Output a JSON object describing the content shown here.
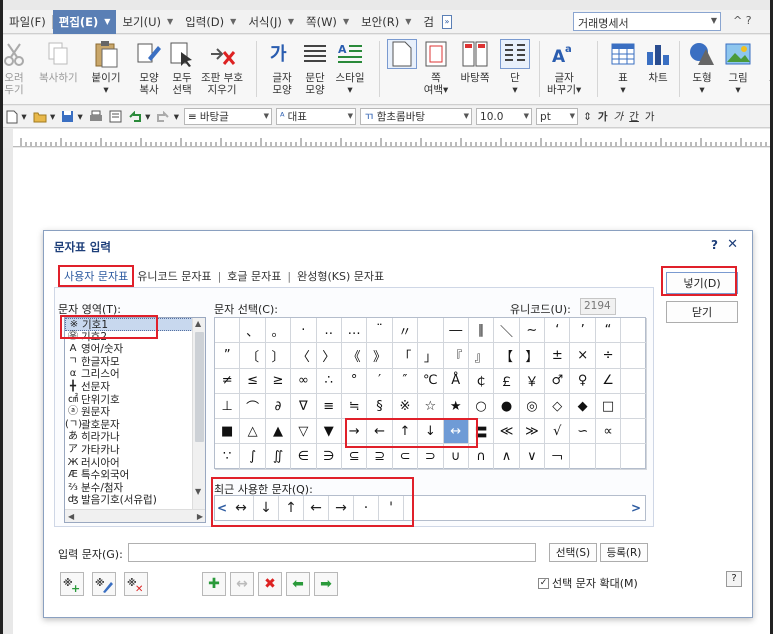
{
  "menubar": {
    "items": [
      {
        "label": "파일(F)",
        "arrow": ""
      },
      {
        "label": "편집(E)",
        "arrow": "▼"
      },
      {
        "label": "보기(U)",
        "arrow": "▼"
      },
      {
        "label": "입력(D)",
        "arrow": "▼"
      },
      {
        "label": "서식(J)",
        "arrow": "▼"
      },
      {
        "label": "쪽(W)",
        "arrow": "▼"
      },
      {
        "label": "보안(R)",
        "arrow": "▼"
      },
      {
        "label": "검",
        "arrow": ""
      }
    ],
    "expand": "»",
    "doc_title": "거래명세서",
    "dd": "▼",
    "winctl": "^ ?"
  },
  "ribbon": {
    "items": [
      {
        "label": "오려\n두기",
        "dim": true
      },
      {
        "label": "복사하기",
        "dim": true
      },
      {
        "label": "붙이기\n▾"
      },
      {
        "label": "모양\n복사"
      },
      {
        "label": "모두\n선택"
      },
      {
        "label": "조판 부호\n지우기"
      },
      {
        "label": "글자\n모양"
      },
      {
        "label": "문단\n모양"
      },
      {
        "label": "스타일\n▾"
      },
      {
        "label": ""
      },
      {
        "label": "쪽\n여백▾"
      },
      {
        "label": "바탕쪽"
      },
      {
        "label": "단\n▾"
      },
      {
        "label": "글자\n바꾸기▾"
      },
      {
        "label": "표\n▾"
      },
      {
        "label": "차트"
      },
      {
        "label": "도형\n▾"
      },
      {
        "label": "그림\n▾"
      },
      {
        "label": "그"
      }
    ]
  },
  "toolbar": {
    "style": "바탕글",
    "style_pre": "≡",
    "lang": "대표",
    "lang_pre": "ᴬ",
    "font": "함초롬바탕",
    "font_pre": "ㄲ",
    "size": "10.0",
    "unit": "pt",
    "spin": "⇕",
    "fmt": [
      "가",
      "가",
      "간",
      "가"
    ]
  },
  "dialog": {
    "title": "문자표 입력",
    "help": "?",
    "close": "✕",
    "tabs": [
      "사용자 문자표",
      "유니코드 문자표",
      "호글 문자표",
      "완성형(KS) 문자표"
    ],
    "tab_sep": "|",
    "area_label": "문자 영역(T):",
    "select_label": "문자 선택(C):",
    "unicode_label": "유니코드(U):",
    "unicode_value": "2194",
    "areas": [
      {
        "glyph": "※",
        "label": "기호1"
      },
      {
        "glyph": "㉾",
        "label": "기호2"
      },
      {
        "glyph": "A",
        "label": "영어/숫자"
      },
      {
        "glyph": "ㄱ",
        "label": "한글자모"
      },
      {
        "glyph": "α",
        "label": "그리스어"
      },
      {
        "glyph": "╋",
        "label": "선문자"
      },
      {
        "glyph": "㎠",
        "label": "단위기호"
      },
      {
        "glyph": "ⓐ",
        "label": "원문자"
      },
      {
        "glyph": "(ㄱ)",
        "label": "괄호문자"
      },
      {
        "glyph": "あ",
        "label": "히라가나"
      },
      {
        "glyph": "ア",
        "label": "가타카나"
      },
      {
        "glyph": "Ж",
        "label": "러시아어"
      },
      {
        "glyph": "Æ",
        "label": "특수외국어"
      },
      {
        "glyph": "⅔",
        "label": "분수/첨자"
      },
      {
        "glyph": "ʤ",
        "label": "발음기호(서유럽)"
      }
    ],
    "grid": [
      "",
      "、",
      "。",
      "·",
      "‥",
      "…",
      "¨",
      "〃",
      "­",
      "―",
      "∥",
      "＼",
      "∼",
      "‘",
      "’",
      "“",
      "",
      "”",
      "〔",
      "〕",
      "〈",
      "〉",
      "《",
      "》",
      "「",
      "」",
      "『",
      "』",
      "【",
      "】",
      "±",
      "×",
      "÷",
      "",
      "≠",
      "≤",
      "≥",
      "∞",
      "∴",
      "°",
      "′",
      "″",
      "℃",
      "Å",
      "￠",
      "￡",
      "￥",
      "♂",
      "♀",
      "∠",
      "",
      "⊥",
      "⌒",
      "∂",
      "∇",
      "≡",
      "≒",
      "§",
      "※",
      "☆",
      "★",
      "○",
      "●",
      "◎",
      "◇",
      "◆",
      "□",
      "",
      "■",
      "△",
      "▲",
      "▽",
      "▼",
      "→",
      "←",
      "↑",
      "↓",
      "↔",
      "〓",
      "≪",
      "≫",
      "√",
      "∽",
      "∝",
      "",
      "∵",
      "∫",
      "∬",
      "∈",
      "∋",
      "⊆",
      "⊇",
      "⊂",
      "⊃",
      "∪",
      "∩",
      "∧",
      "∨",
      "￢",
      "",
      "",
      ""
    ],
    "selected_glyph": "↔",
    "recent_label": "최근 사용한 문자(Q):",
    "recent": [
      "↔",
      "↓",
      "↑",
      "←",
      "→",
      "·",
      "'"
    ],
    "recent_left": "<",
    "recent_right": ">",
    "insert_btn": "넣기(D)",
    "close_btn": "닫기",
    "input_label": "입력 문자(G):",
    "select_btn": "선택(S)",
    "register_btn": "등록(R)",
    "zoom_label": "선택 문자 확대(M)",
    "zoom_checked": "✓",
    "help_q": "?",
    "tool_icons": [
      "✚",
      "↔",
      "✖",
      "⬅",
      "➡"
    ]
  }
}
